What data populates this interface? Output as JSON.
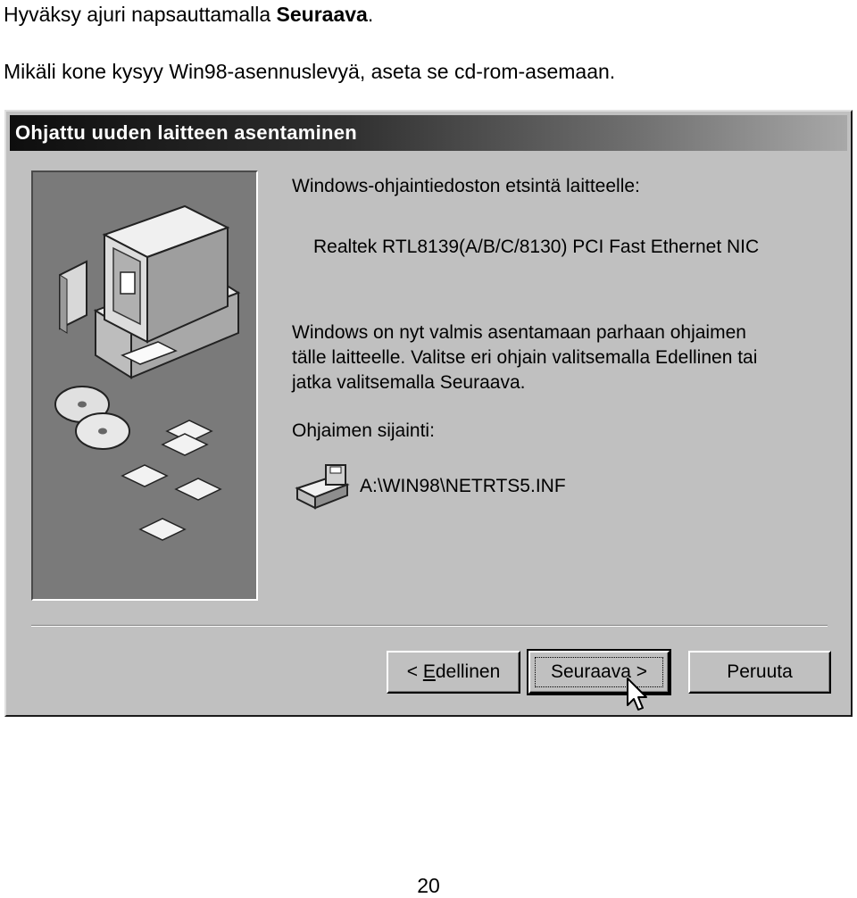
{
  "instructions": {
    "line1_prefix": "Hyväksy ajuri napsauttamalla ",
    "line1_bold": "Seuraava",
    "line1_suffix": ".",
    "line2": "Mikäli kone kysyy Win98-asennuslevyä, aseta se cd-rom-asemaan."
  },
  "dialog": {
    "title": "Ohjattu uuden laitteen asentaminen",
    "search_label": "Windows-ohjaintiedoston etsintä laitteelle:",
    "device_name": "Realtek RTL8139(A/B/C/8130) PCI Fast Ethernet NIC",
    "message_lines": [
      "Windows on nyt valmis asentamaan parhaan ohjaimen",
      "tälle laitteelle. Valitse eri ohjain valitsemalla Edellinen tai",
      "jatka valitsemalla Seuraava."
    ],
    "location_label": "Ohjaimen sijainti:",
    "driver_path": "A:\\WIN98\\NETRTS5.INF",
    "buttons": {
      "back_prefix": "< ",
      "back_mnemonic": "E",
      "back_rest": "dellinen",
      "next": "Seuraava >",
      "cancel": "Peruuta"
    }
  },
  "page_number": "20",
  "icons": [
    "computer-illustration",
    "cd-icon",
    "floppy-icon",
    "floppy-drive-icon",
    "mouse-cursor-icon"
  ]
}
